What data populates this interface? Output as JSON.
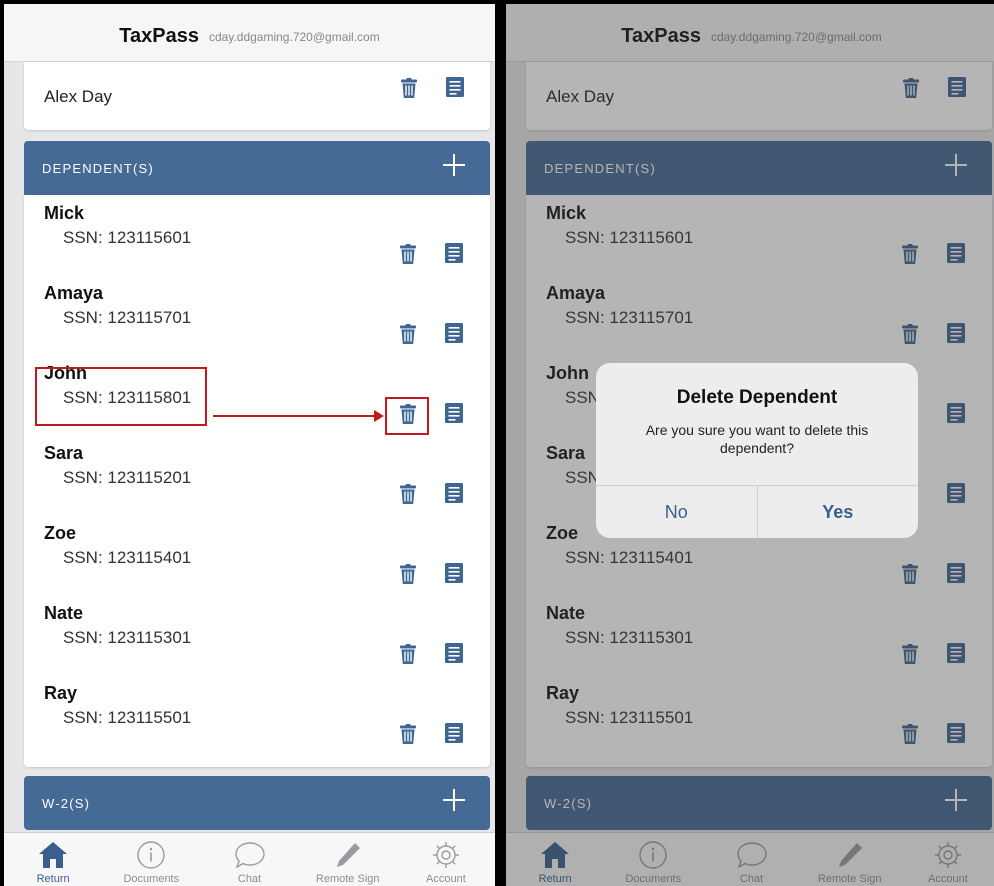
{
  "header": {
    "title": "TaxPass",
    "email": "cday.ddgaming.720@gmail.com"
  },
  "taxpayer": {
    "name": "Alex Day"
  },
  "dependents_section": {
    "title": "DEPENDENT(S)"
  },
  "dependents": [
    {
      "name": "Mick",
      "ssn": "SSN: 123115601"
    },
    {
      "name": "Amaya",
      "ssn": "SSN: 123115701"
    },
    {
      "name": "John",
      "ssn": "SSN: 123115801"
    },
    {
      "name": "Sara",
      "ssn": "SSN: 123115201"
    },
    {
      "name": "Zoe",
      "ssn": "SSN: 123115401"
    },
    {
      "name": "Nate",
      "ssn": "SSN: 123115301"
    },
    {
      "name": "Ray",
      "ssn": "SSN: 123115501"
    }
  ],
  "w2_section": {
    "title": "W-2(S)"
  },
  "tabbar": {
    "tabs": [
      {
        "label": "Return",
        "icon": "home-icon",
        "active": true
      },
      {
        "label": "Documents",
        "icon": "info-icon",
        "active": false
      },
      {
        "label": "Chat",
        "icon": "chat-bubble-icon",
        "active": false
      },
      {
        "label": "Remote Sign",
        "icon": "pencil-icon",
        "active": false
      },
      {
        "label": "Account",
        "icon": "gear-icon",
        "active": false
      }
    ]
  },
  "dialog": {
    "title": "Delete Dependent",
    "message": "Are you sure you want to delete this dependent?",
    "no_label": "No",
    "yes_label": "Yes"
  },
  "colors": {
    "section_header": "#446a95",
    "icon_blue": "#3f6592",
    "accent": "#3a5f8f",
    "highlight_red": "#c0191f"
  }
}
